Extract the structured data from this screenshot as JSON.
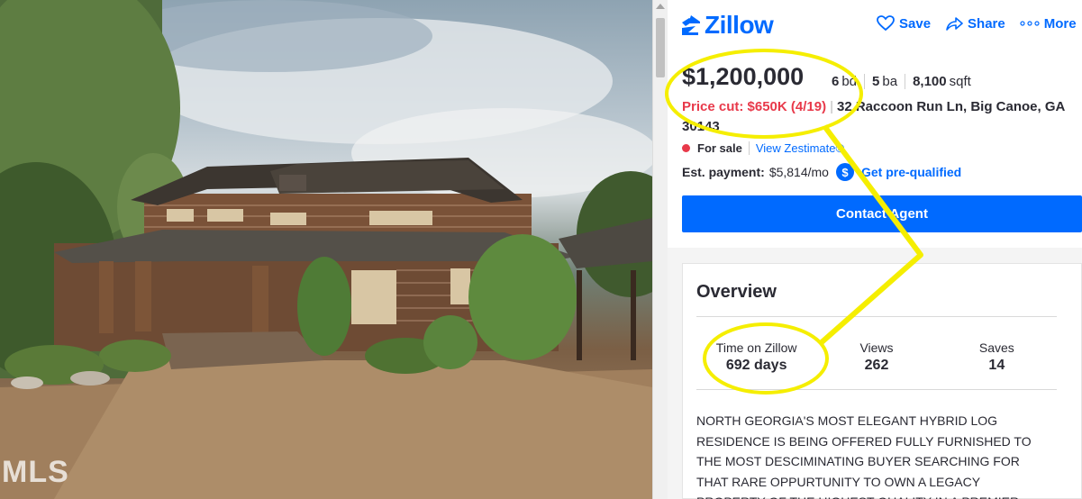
{
  "photo": {
    "watermark": "MLS"
  },
  "header": {
    "logo_text": "Zillow",
    "actions": [
      {
        "label": "Save",
        "icon": "heart-icon"
      },
      {
        "label": "Share",
        "icon": "share-icon"
      },
      {
        "label": "More",
        "icon": "more-icon"
      }
    ]
  },
  "listing": {
    "price": "$1,200,000",
    "beds_value": "6",
    "beds_unit": "bd",
    "baths_value": "5",
    "baths_unit": "ba",
    "sqft_value": "8,100",
    "sqft_unit": "sqft",
    "price_cut": "Price cut: $650K (4/19)",
    "address": "32 Raccoon Run Ln, Big Canoe, GA 30143",
    "status": "For sale",
    "zestimate_link": "View Zestimate®",
    "payment_label": "Est. payment:",
    "payment_value": "$5,814/mo",
    "prequal_icon": "$",
    "prequal_label": "Get pre-qualified",
    "contact_button": "Contact Agent"
  },
  "overview": {
    "title": "Overview",
    "stats": [
      {
        "label": "Time on Zillow",
        "value": "692 days"
      },
      {
        "label": "Views",
        "value": "262"
      },
      {
        "label": "Saves",
        "value": "14"
      }
    ],
    "description": "NORTH GEORGIA'S MOST ELEGANT HYBRID LOG RESIDENCE IS BEING OFFERED FULLY FURNISHED TO THE MOST DESCIMINATING BUYER SEARCHING FOR THAT RARE OPPURTUNITY TO OWN A LEGACY PROPERTY OF THE HIGHEST QUALITY IN A PREMIER"
  },
  "colors": {
    "brand_blue": "#006aff",
    "price_cut_red": "#e8394a",
    "annotation_yellow": "#f5ee00"
  }
}
